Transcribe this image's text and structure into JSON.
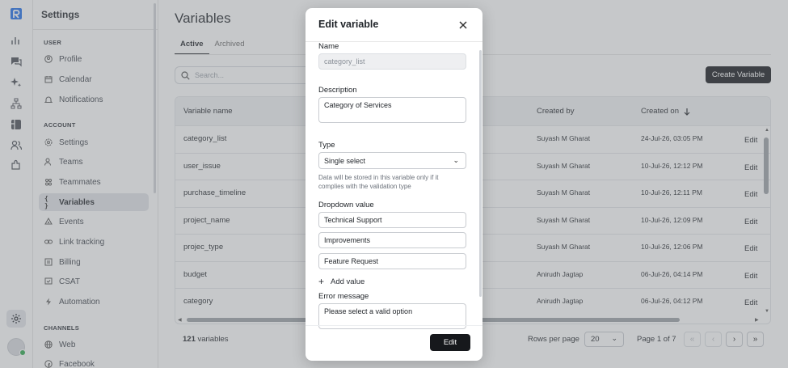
{
  "sidebar": {
    "title": "Settings",
    "sections": [
      {
        "label": "USER"
      },
      {
        "label": "ACCOUNT"
      },
      {
        "label": "CHANNELS"
      }
    ],
    "items": [
      {
        "label": "Profile",
        "icon": "user-circle-icon"
      },
      {
        "label": "Calendar",
        "icon": "calendar-icon"
      },
      {
        "label": "Notifications",
        "icon": "bell-icon"
      },
      {
        "label": "Settings",
        "icon": "gear-icon"
      },
      {
        "label": "Teams",
        "icon": "users-icon"
      },
      {
        "label": "Teammates",
        "icon": "teammates-icon"
      },
      {
        "label": "Variables",
        "icon": "braces-icon",
        "active": true
      },
      {
        "label": "Events",
        "icon": "events-icon"
      },
      {
        "label": "Link tracking",
        "icon": "link-icon"
      },
      {
        "label": "Billing",
        "icon": "billing-icon"
      },
      {
        "label": "CSAT",
        "icon": "csat-icon"
      },
      {
        "label": "Automation",
        "icon": "bolt-icon"
      },
      {
        "label": "Web",
        "icon": "globe-icon"
      },
      {
        "label": "Facebook",
        "icon": "facebook-icon"
      }
    ]
  },
  "page": {
    "title": "Variables",
    "tabs": [
      {
        "label": "Active",
        "active": true
      },
      {
        "label": "Archived"
      }
    ],
    "search_placeholder": "Search...",
    "create_button": "Create Variable"
  },
  "table": {
    "columns": [
      "Variable name",
      "Created by",
      "Created on"
    ],
    "rows": [
      {
        "name": "category_list",
        "created_by": "Suyash M Gharat",
        "created_on": "24-Jul-26, 03:05 PM",
        "action": "Edit"
      },
      {
        "name": "user_issue",
        "created_by": "Suyash M Gharat",
        "created_on": "10-Jul-26, 12:12 PM",
        "action": "Edit"
      },
      {
        "name": "purchase_timeline",
        "created_by": "Suyash M Gharat",
        "created_on": "10-Jul-26, 12:11 PM",
        "action": "Edit"
      },
      {
        "name": "project_name",
        "created_by": "Suyash M Gharat",
        "created_on": "10-Jul-26, 12:09 PM",
        "action": "Edit"
      },
      {
        "name": "projec_type",
        "created_by": "Suyash M Gharat",
        "created_on": "10-Jul-26, 12:06 PM",
        "action": "Edit"
      },
      {
        "name": "budget",
        "created_by": "Anirudh Jagtap",
        "created_on": "06-Jul-26, 04:14 PM",
        "action": "Edit"
      },
      {
        "name": "category",
        "created_by": "Anirudh Jagtap",
        "created_on": "06-Jul-26, 04:12 PM",
        "action": "Edit"
      }
    ]
  },
  "footer": {
    "count": "121",
    "count_label": "variables",
    "rows_per_page_label": "Rows per page",
    "rows_per_page_value": "20",
    "page_label": "Page 1 of 7"
  },
  "modal": {
    "title": "Edit variable",
    "name_label": "Name",
    "name_value": "category_list",
    "description_label": "Description",
    "description_value": "Category of Services",
    "type_label": "Type",
    "type_value": "Single select",
    "type_help": "Data will be stored in this variable only if it complies with the validation type",
    "dropdown_label": "Dropdown value",
    "dropdown_values": [
      "Technical Support",
      "Improvements",
      "Feature Request"
    ],
    "add_value_label": "Add value",
    "error_label": "Error message",
    "error_value": "Please select a valid option",
    "submit_label": "Edit"
  },
  "colors": {
    "accent_dark": "#16181c",
    "brand_blue": "#1f6feb",
    "online_green": "#2eaa4f"
  }
}
